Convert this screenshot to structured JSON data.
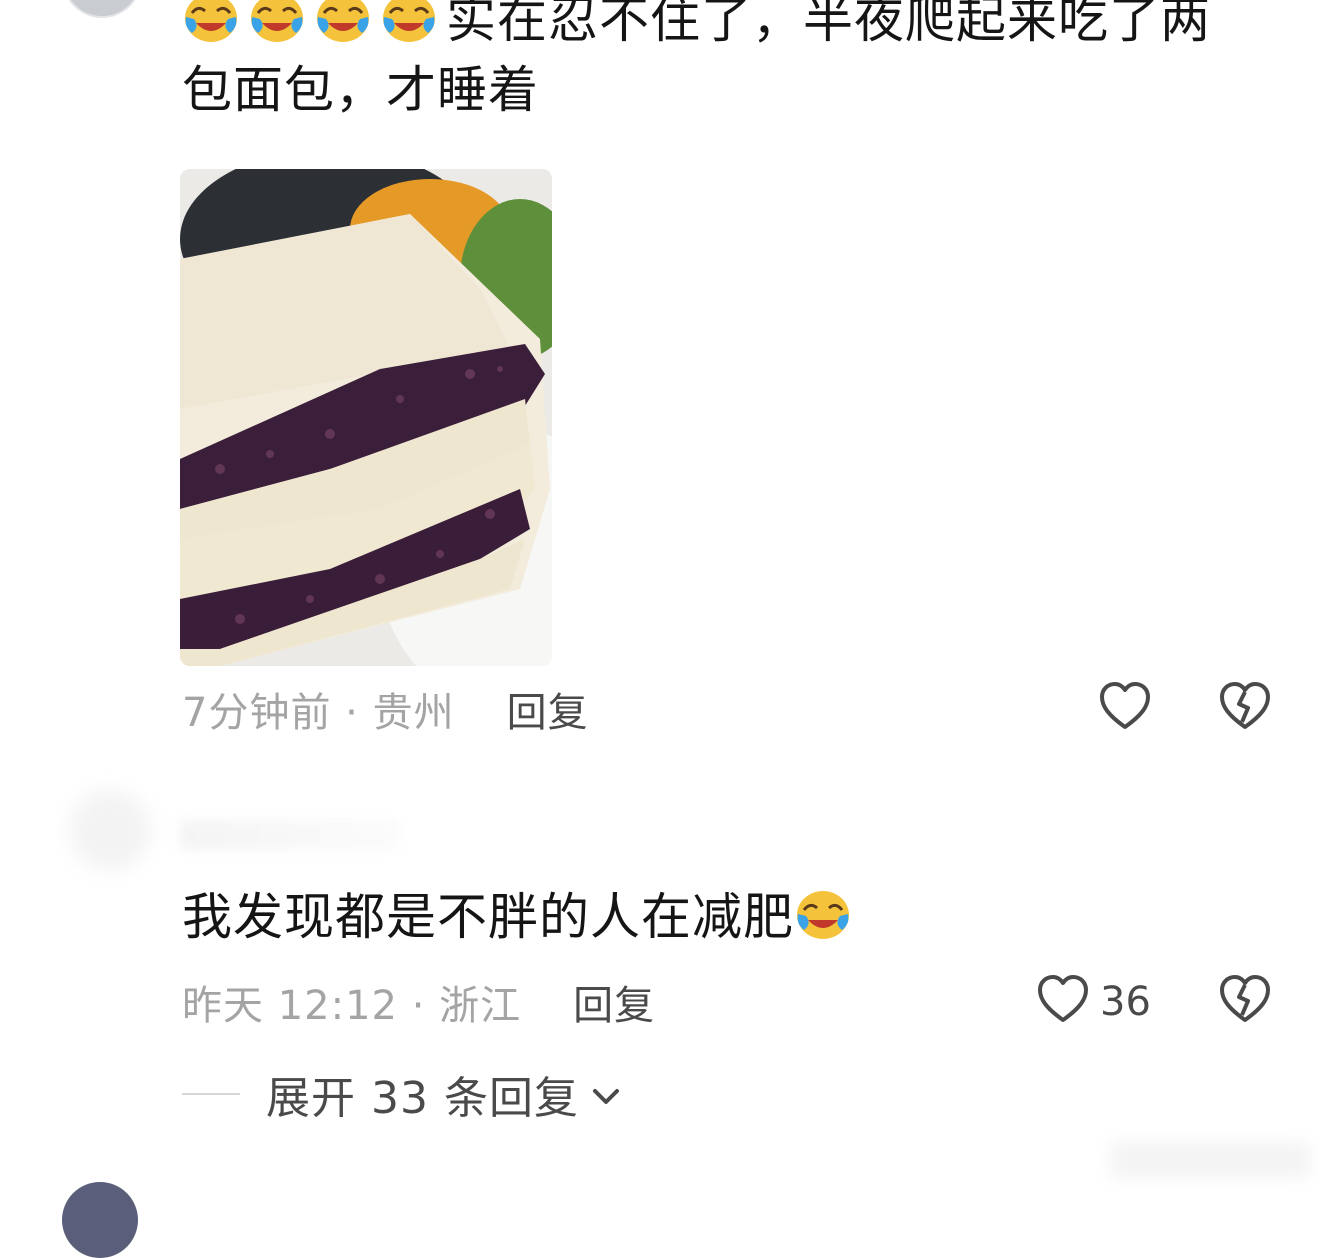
{
  "comments": [
    {
      "text": "实在忍不住了，半夜爬起来吃了两包面包，才睡着",
      "emoji_prefix": [
        "crying-laughing-emoji",
        "crying-laughing-emoji",
        "crying-laughing-emoji",
        "crying-laughing-emoji"
      ],
      "time_location": "7分钟前 · 贵州",
      "reply_label": "回复",
      "like_count": ""
    },
    {
      "text": "我发现都是不胖的人在减肥",
      "emoji_suffix": [
        "crying-laughing-emoji"
      ],
      "time_location": "昨天 12:12 · 浙江",
      "reply_label": "回复",
      "like_count": "36",
      "expand_replies": "展开 33 条回复"
    }
  ],
  "colors": {
    "text": "#151515",
    "meta": "#a4a4a4",
    "action": "#4a4a4a"
  }
}
